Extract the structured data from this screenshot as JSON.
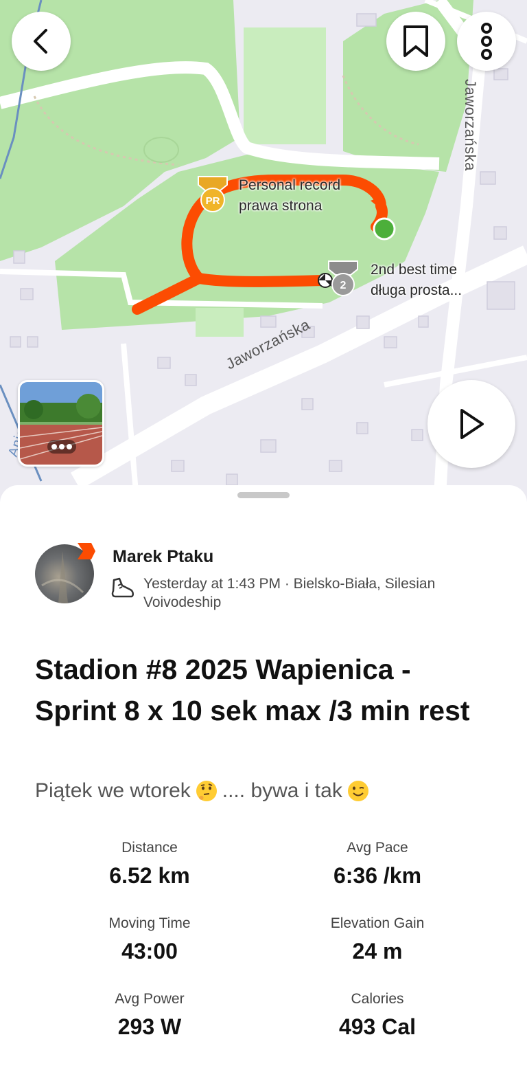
{
  "map": {
    "road_label_1": "Jaworzańska",
    "road_label_2": "Jaworzańska",
    "road_label_3": "Aniol",
    "segments": [
      {
        "badge": "PR",
        "line1": "Personal record",
        "line2": "prawa strona"
      },
      {
        "badge": "2",
        "line1": "2nd best time",
        "line2": "długa prosta..."
      }
    ],
    "photo_count_dots": 3
  },
  "icons": {
    "back": "chevron-left-icon",
    "bookmark": "bookmark-icon",
    "more": "more-vertical-icon",
    "play": "play-icon",
    "shoe": "running-shoe-icon",
    "pr": "pr-medal-icon",
    "second": "silver-medal-icon"
  },
  "colors": {
    "route": "#fc4c02",
    "start": "#4caf3a",
    "park": "#b6e3a8",
    "water": "#6a8fc0"
  },
  "athlete": {
    "name": "Marek Ptaku",
    "meta": "Yesterday at 1:43 PM · Bielsko-Biała, Silesian Voivodeship"
  },
  "activity": {
    "title": "Stadion #8 2025 Wapienica - Sprint 8 x 10 sek max /3 min rest",
    "description_part1": "Piątek we wtorek",
    "description_part2": ".... bywa i tak",
    "emoji1": "thinking-face-icon",
    "emoji2": "winking-face-icon"
  },
  "stats": [
    {
      "label": "Distance",
      "value": "6.52 km"
    },
    {
      "label": "Avg Pace",
      "value": "6:36 /km"
    },
    {
      "label": "Moving Time",
      "value": "43:00"
    },
    {
      "label": "Elevation Gain",
      "value": "24 m"
    },
    {
      "label": "Avg Power",
      "value": "293 W"
    },
    {
      "label": "Calories",
      "value": "493 Cal"
    }
  ]
}
